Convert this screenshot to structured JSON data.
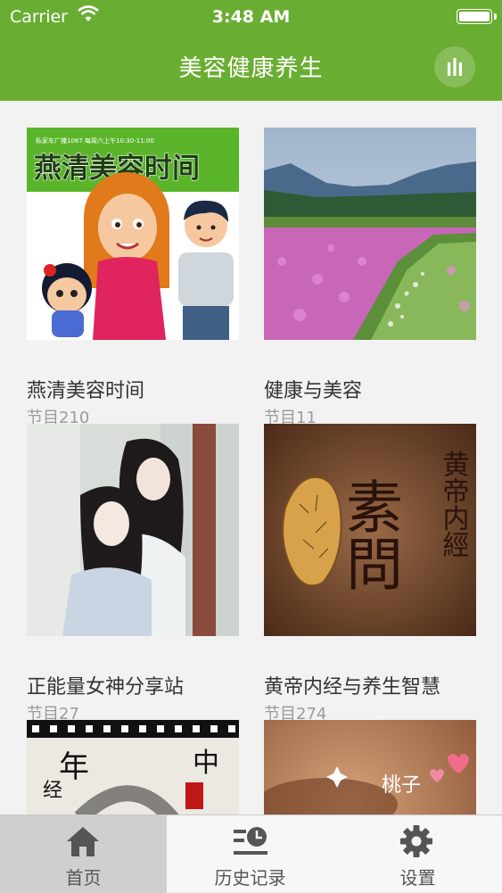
{
  "status_bar": {
    "carrier": "Carrier",
    "time": "3:48 AM"
  },
  "header": {
    "title": "美容健康养生",
    "player_icon": "audio-bars-icon"
  },
  "programs": [
    {
      "title": "燕清美容时间",
      "episode_prefix": "节目",
      "episode_count": "210",
      "thumb": {
        "station_line": "私家车广播1067  每周六上午10:30-11:00",
        "headline": "燕清美容时间"
      }
    },
    {
      "title": "健康与美容",
      "episode_prefix": "节目",
      "episode_count": "11"
    },
    {
      "title": "正能量女神分享站",
      "episode_prefix": "节目",
      "episode_count": "27"
    },
    {
      "title": "黄帝内经与养生智慧",
      "episode_prefix": "节目",
      "episode_count": "274",
      "thumb": {
        "big_chars": "素問",
        "vertical_text": "黄帝内經"
      }
    },
    {
      "title": "",
      "thumb": {
        "chars_a": "年",
        "chars_b": "中",
        "chars_c": "经"
      }
    },
    {
      "title": "",
      "thumb": {
        "text": "桃子"
      }
    }
  ],
  "tabs": [
    {
      "label": "首页",
      "icon": "home-icon",
      "active": true
    },
    {
      "label": "历史记录",
      "icon": "history-icon",
      "active": false
    },
    {
      "label": "设置",
      "icon": "gear-icon",
      "active": false
    }
  ],
  "colors": {
    "brand_green": "#6aad33",
    "background": "#f2f2f2",
    "tab_active": "#cfcfcf"
  }
}
